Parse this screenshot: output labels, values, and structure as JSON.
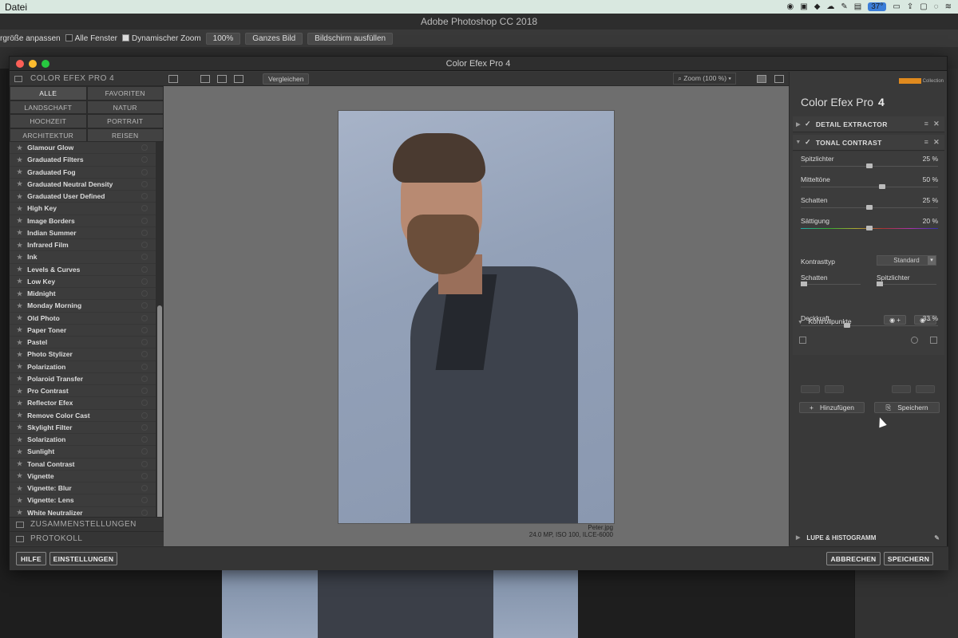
{
  "menubar": {
    "app_menu": "Datei",
    "battery_badge": "37°"
  },
  "ps": {
    "title": "Adobe Photoshop CC 2018",
    "options": {
      "fit_label": "rgröße anpassen",
      "all_windows": "Alle Fenster",
      "dyn_zoom": "Dynamischer Zoom",
      "zoom": "100%",
      "whole": "Ganzes Bild",
      "fill": "Bildschirm ausfüllen"
    }
  },
  "window": {
    "title": "Color Efex Pro 4"
  },
  "left": {
    "header": "COLOR EFEX PRO 4",
    "categories": [
      "ALLE",
      "FAVORITEN",
      "LANDSCHAFT",
      "NATUR",
      "HOCHZEIT",
      "PORTRAIT",
      "ARCHITEKTUR",
      "REISEN"
    ],
    "filters": [
      "Glamour Glow",
      "Graduated Filters",
      "Graduated Fog",
      "Graduated Neutral Density",
      "Graduated User Defined",
      "High Key",
      "Image Borders",
      "Indian Summer",
      "Infrared Film",
      "Ink",
      "Levels & Curves",
      "Low Key",
      "Midnight",
      "Monday Morning",
      "Old Photo",
      "Paper Toner",
      "Pastel",
      "Photo Stylizer",
      "Polarization",
      "Polaroid Transfer",
      "Pro Contrast",
      "Reflector Efex",
      "Remove Color Cast",
      "Skylight Filter",
      "Solarization",
      "Sunlight",
      "Tonal Contrast",
      "Vignette",
      "Vignette: Blur",
      "Vignette: Lens",
      "White Neutralizer"
    ],
    "recipes": "ZUSAMMENSTELLUNGEN",
    "history": "PROTOKOLL"
  },
  "preview": {
    "compare": "Vergleichen",
    "zoom": "Zoom (100 %)",
    "file": "Peter.jpg",
    "meta": "24.0 MP, ISO 100, ILCE-6000"
  },
  "right": {
    "brand": "Color Efex Pro",
    "version": "4",
    "collection": "Collection",
    "filter1": "DETAIL EXTRACTOR",
    "filter2": "TONAL CONTRAST",
    "sliders": [
      {
        "label": "Spitzlichter",
        "value": "25 %",
        "level": 0.5
      },
      {
        "label": "Mitteltöne",
        "value": "50 %",
        "level": 0.6
      },
      {
        "label": "Schatten",
        "value": "25 %",
        "level": 0.5
      },
      {
        "label": "Sättigung",
        "value": "20 %",
        "level": 0.5
      }
    ],
    "kontrasttyp": "Kontrasttyp",
    "kontrast_value": "Standard",
    "schatten": "Schatten",
    "spitzlichter": "Spitzlichter",
    "kontrollpunkte": "Kontrollpunkte",
    "deckkraft": "Deckkraft",
    "deckkraft_value": "33 %",
    "deckkraft_level": 0.33,
    "add": "Hinzufügen",
    "save": "Speichern",
    "lupe": "LUPE & HISTOGRAMM"
  },
  "bottom": {
    "help": "HILFE",
    "settings": "EINSTELLUNGEN",
    "cancel": "ABBRECHEN",
    "save": "SPEICHERN"
  }
}
